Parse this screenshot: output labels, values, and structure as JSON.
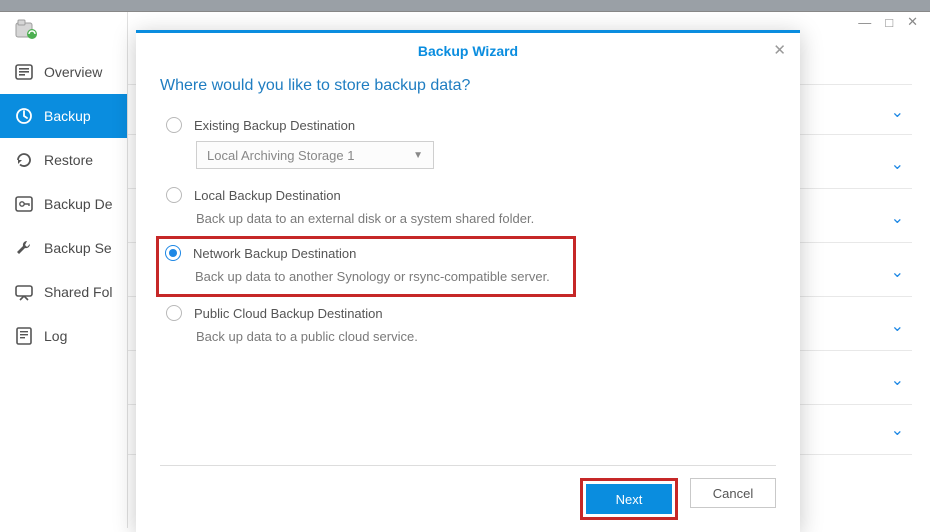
{
  "window": {
    "controls": {
      "min": "—",
      "max": "□",
      "close": "✕"
    }
  },
  "sidebar": {
    "items": [
      {
        "label": "Overview"
      },
      {
        "label": "Backup"
      },
      {
        "label": "Restore"
      },
      {
        "label": "Backup De"
      },
      {
        "label": "Backup Se"
      },
      {
        "label": "Shared Fol"
      },
      {
        "label": "Log"
      }
    ]
  },
  "modal": {
    "title": "Backup Wizard",
    "close_glyph": "✕",
    "question": "Where would you like to store backup data?",
    "options": [
      {
        "label": "Existing Backup Destination",
        "select_value": "Local Archiving Storage 1"
      },
      {
        "label": "Local Backup Destination",
        "desc": "Back up data to an external disk or a system shared folder."
      },
      {
        "label": "Network Backup Destination",
        "desc": "Back up data to another Synology or rsync-compatible server."
      },
      {
        "label": "Public Cloud Backup Destination",
        "desc": "Back up data to a public cloud service."
      }
    ],
    "footer": {
      "next": "Next",
      "cancel": "Cancel"
    }
  }
}
